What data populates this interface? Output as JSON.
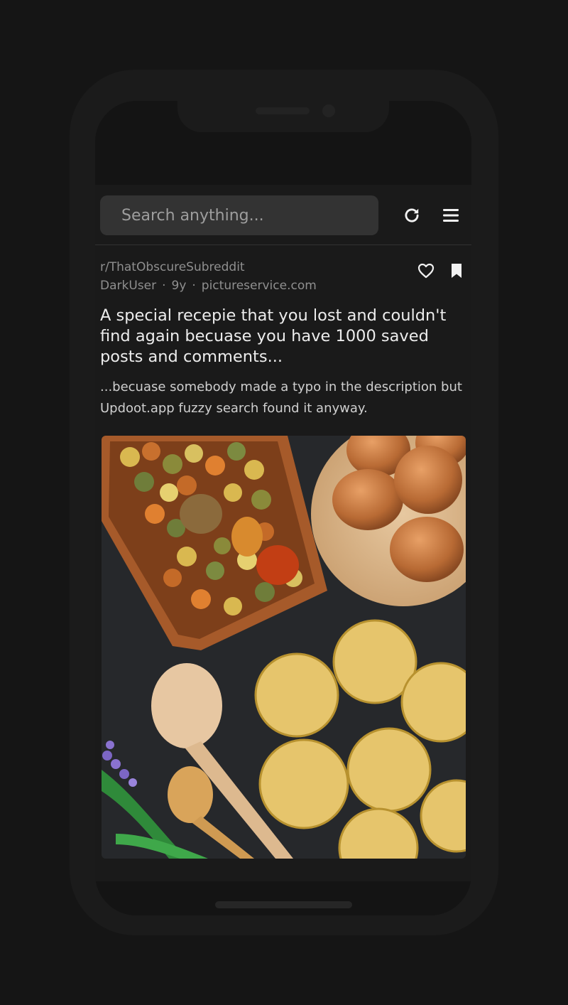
{
  "search": {
    "placeholder": "Search anything..."
  },
  "toolbar": {
    "refresh_icon": "refresh-icon",
    "menu_icon": "hamburger-menu-icon"
  },
  "post": {
    "subreddit": "r/ThatObscureSubreddit",
    "author": "DarkUser",
    "age": "9y",
    "domain": "pictureservice.com",
    "separator": "·",
    "title": "A special recepie that you lost and couldn't find again becuase you have 1000 saved posts and comments...",
    "description": "...becuase somebody made a typo in the description but Updoot.app fuzzy search found it anyway.",
    "actions": {
      "like_icon": "heart-icon",
      "save_icon": "bookmark-icon"
    },
    "image": "pasta, eggs and wooden spoons on dark board"
  },
  "colors": {
    "background": "#151515",
    "app_background": "#1a1a1a",
    "search_background": "#333333",
    "muted_text": "#8f8f8f",
    "title_text": "#ececec"
  }
}
